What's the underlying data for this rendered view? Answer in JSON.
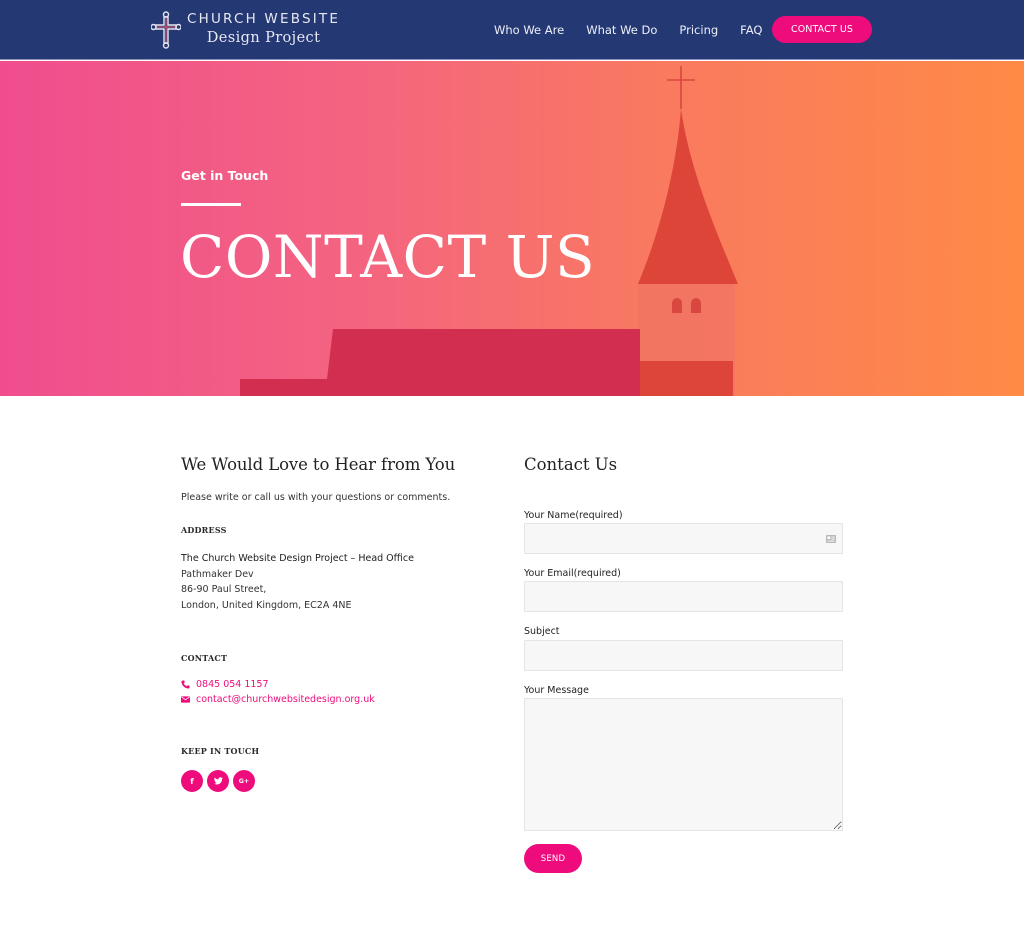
{
  "header": {
    "logo_line1": "CHURCH WEBSITE",
    "logo_line2": "Design Project",
    "logo_icon": "cross-icon",
    "nav": [
      {
        "label": "Who We Are"
      },
      {
        "label": "What We Do"
      },
      {
        "label": "Pricing"
      },
      {
        "label": "FAQ"
      }
    ],
    "cta_label": "CONTACT US"
  },
  "hero": {
    "eyebrow": "Get in Touch",
    "title": "CONTACT US",
    "gradient": [
      "#f04d8e",
      "#ff8a46"
    ]
  },
  "info": {
    "heading": "We Would Love to Hear from You",
    "intro": "Please write or call us with your questions or comments.",
    "address_label": "ADDRESS",
    "address_lines": [
      "The Church Website Design Project – Head Office",
      "Pathmaker Dev",
      "86-90 Paul Street,",
      "London, United Kingdom, EC2A 4NE"
    ],
    "contact_label": "CONTACT",
    "phone": {
      "icon": "phone-icon",
      "value": "0845 054 1157"
    },
    "email": {
      "icon": "envelope-icon",
      "value": "contact@churchwebsitedesign.org.uk"
    },
    "keep_in_touch_label": "KEEP IN TOUCH",
    "social": [
      {
        "icon": "facebook-icon",
        "glyph": "f"
      },
      {
        "icon": "twitter-icon",
        "glyph": "t"
      },
      {
        "icon": "google-plus-icon",
        "glyph": "G+"
      }
    ]
  },
  "form": {
    "heading": "Contact Us",
    "fields": [
      {
        "label": "Your Name(required)",
        "value": "",
        "placeholder": ""
      },
      {
        "label": "Your Email(required)",
        "value": "",
        "placeholder": ""
      },
      {
        "label": "Subject",
        "value": "",
        "placeholder": ""
      },
      {
        "label": "Your Message",
        "value": "",
        "placeholder": ""
      }
    ],
    "submit_label": "SEND"
  },
  "colors": {
    "header_bg": "#243873",
    "accent": "#ee0c7c",
    "input_bg": "#f7f7f7"
  }
}
